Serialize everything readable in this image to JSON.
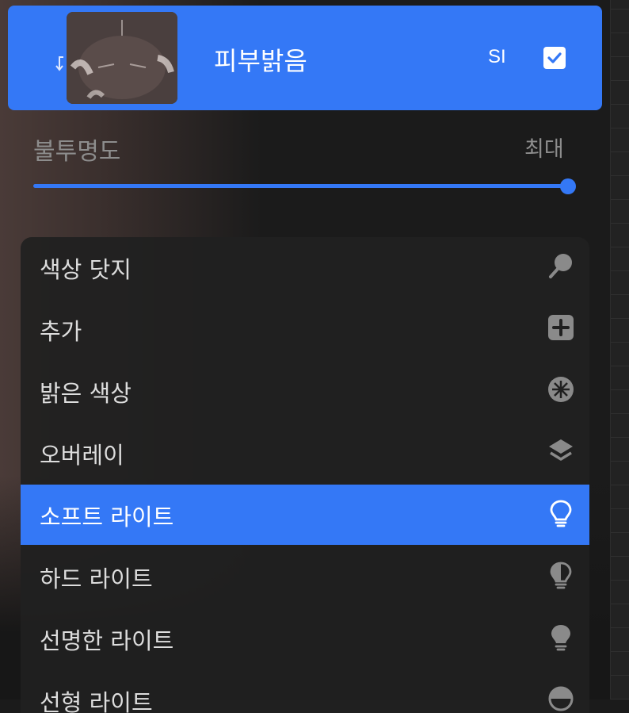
{
  "layer": {
    "name": "피부밝음",
    "blend_code": "SI",
    "visible": true
  },
  "opacity": {
    "label": "불투명도",
    "value_label": "최대",
    "level": 1.0
  },
  "blend_modes": [
    {
      "label": "색상 닷지",
      "icon": "magnifier-icon",
      "selected": false
    },
    {
      "label": "추가",
      "icon": "plus-square-icon",
      "selected": false
    },
    {
      "label": "밝은 색상",
      "icon": "starburst-icon",
      "selected": false
    },
    {
      "label": "오버레이",
      "icon": "layers-icon",
      "selected": false
    },
    {
      "label": "소프트 라이트",
      "icon": "lightbulb-outline-icon",
      "selected": true
    },
    {
      "label": "하드 라이트",
      "icon": "lightbulb-half-icon",
      "selected": false
    },
    {
      "label": "선명한 라이트",
      "icon": "lightbulb-filled-icon",
      "selected": false
    },
    {
      "label": "선형 라이트",
      "icon": "half-circle-icon",
      "selected": false
    }
  ],
  "colors": {
    "accent": "#3478f6",
    "panel": "#202020",
    "muted_text": "#8d8d8d"
  }
}
